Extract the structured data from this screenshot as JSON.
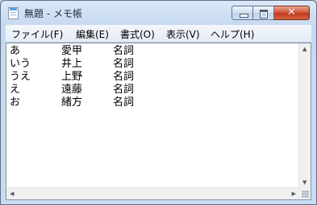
{
  "window": {
    "title": "無題 - メモ帳",
    "minimize_glyph": "",
    "maximize_glyph": "",
    "close_glyph": "✕"
  },
  "menu": {
    "items": [
      {
        "label": "ファイル(F)"
      },
      {
        "label": "編集(E)"
      },
      {
        "label": "書式(O)"
      },
      {
        "label": "表示(V)"
      },
      {
        "label": "ヘルプ(H)"
      }
    ]
  },
  "editor": {
    "lines": [
      {
        "kana": "あ",
        "name": "愛甲",
        "pos": "名詞"
      },
      {
        "kana": "いう",
        "name": "井上",
        "pos": "名詞"
      },
      {
        "kana": "うえ",
        "name": "上野",
        "pos": "名詞"
      },
      {
        "kana": "え",
        "name": "遠藤",
        "pos": "名詞"
      },
      {
        "kana": "お",
        "name": "緒方",
        "pos": "名詞"
      }
    ]
  },
  "scrollbars": {
    "up": "▲",
    "down": "▼",
    "left": "◀",
    "right": "▶"
  }
}
